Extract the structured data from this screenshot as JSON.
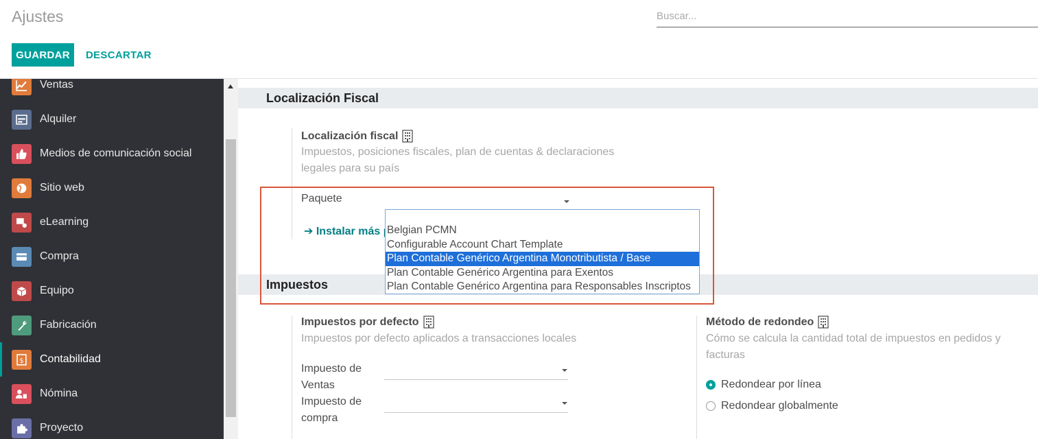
{
  "header": {
    "title": "Ajustes",
    "search_placeholder": "Buscar...",
    "save_label": "GUARDAR",
    "discard_label": "DESCARTAR"
  },
  "sidebar": {
    "items": [
      {
        "label": "Ventas",
        "icon": "chart-line-icon",
        "color": "#e07b3c"
      },
      {
        "label": "Alquiler",
        "icon": "calendar-icon",
        "color": "#5b6d8e"
      },
      {
        "label": "Medios de comunicación social",
        "icon": "thumbs-up-icon",
        "color": "#d9505c"
      },
      {
        "label": "Sitio web",
        "icon": "globe-icon",
        "color": "#e07b3c"
      },
      {
        "label": "eLearning",
        "icon": "elearning-icon",
        "color": "#c04a4a"
      },
      {
        "label": "Compra",
        "icon": "credit-card-icon",
        "color": "#5b8ab5"
      },
      {
        "label": "Equipo",
        "icon": "box-icon",
        "color": "#c04a4a"
      },
      {
        "label": "Fabricación",
        "icon": "wrench-icon",
        "color": "#4e9b7d"
      },
      {
        "label": "Contabilidad",
        "icon": "invoice-icon",
        "color": "#e07b3c"
      },
      {
        "label": "Nómina",
        "icon": "payroll-icon",
        "color": "#d9505c"
      },
      {
        "label": "Proyecto",
        "icon": "puzzle-icon",
        "color": "#6a6fa8"
      }
    ],
    "active_index": 8
  },
  "fiscal": {
    "section_title": "Localización Fiscal",
    "setting_title": "Localización fiscal",
    "setting_desc_line1": "Impuestos, posiciones fiscales, plan de cuentas & declaraciones",
    "setting_desc_line2": "legales para su país",
    "package_label": "Paquete",
    "install_link": "Instalar más p",
    "dropdown_options": [
      "Belgian PCMN",
      "Configurable Account Chart Template",
      "Plan Contable Genérico Argentina Monotributista / Base",
      "Plan Contable Genérico Argentina para Exentos",
      "Plan Contable Genérico Argentina para Responsables Inscriptos"
    ],
    "selected_option_index": 2
  },
  "taxes": {
    "section_title": "Impuestos",
    "default_title": "Impuestos por defecto",
    "default_desc": "Impuestos por defecto aplicados a transacciones locales",
    "sales_tax_label_line1": "Impuesto de",
    "sales_tax_label_line2": "Ventas",
    "purchase_tax_label_line1": "Impuesto de",
    "purchase_tax_label_line2": "compra",
    "rounding_title": "Método de redondeo",
    "rounding_desc_line1": "Cómo se calcula la cantidad total de impuestos en pedidos y",
    "rounding_desc_line2": "facturas",
    "rounding_options": [
      "Redondear por línea",
      "Redondear globalmente"
    ],
    "rounding_selected": 0
  },
  "colors": {
    "accent": "#00a09d",
    "highlight_border": "#d8553a",
    "dropdown_selected": "#1e6fd9"
  }
}
